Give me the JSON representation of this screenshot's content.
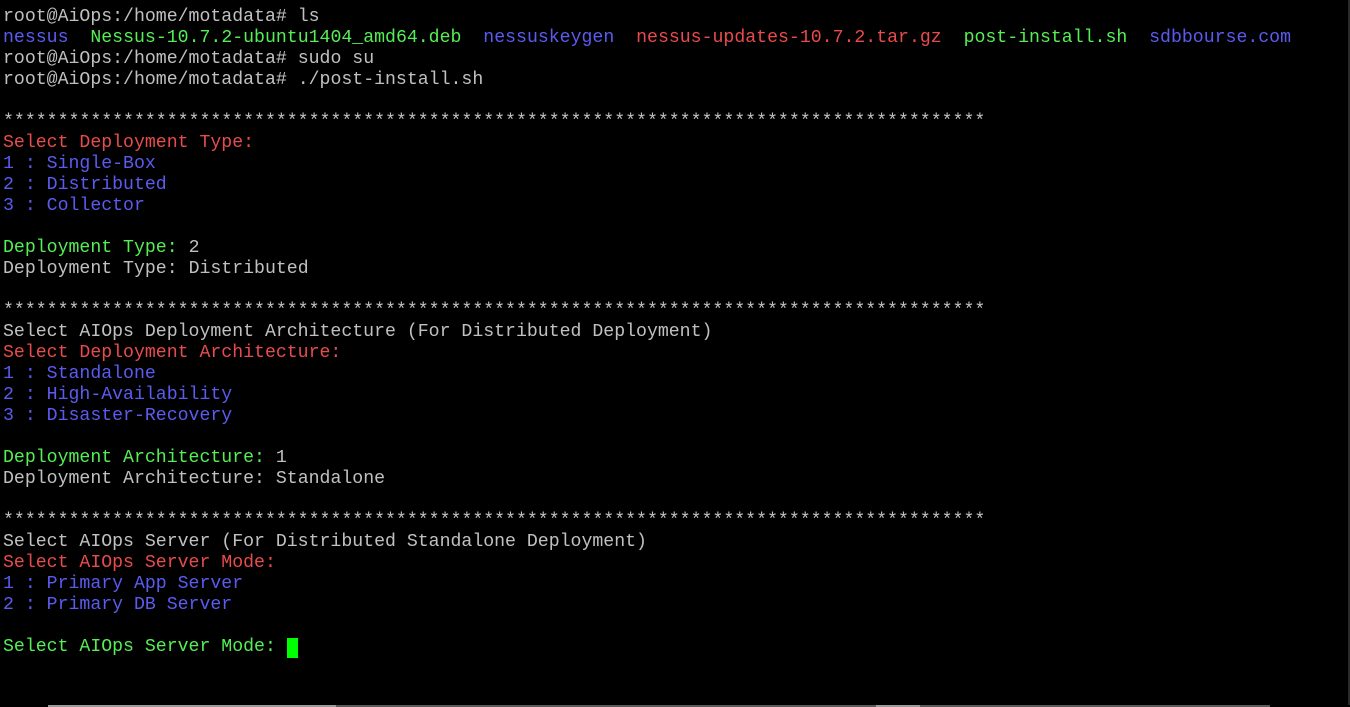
{
  "colors": {
    "background": "#000000",
    "default_text": "#c0c0c0",
    "red": "#e84b4b",
    "blue": "#5b5bf0",
    "green": "#55ee55",
    "cursor": "#00ff00"
  },
  "prompt": "root@AiOps:/home/motadata#",
  "commands": {
    "ls": "ls",
    "sudo": "sudo su",
    "script": "./post-install.sh"
  },
  "ls_output": [
    {
      "name": "nessus",
      "color": "blue"
    },
    {
      "name": "Nessus-10.7.2-ubuntu1404_amd64.deb",
      "color": "green"
    },
    {
      "name": "nessuskeygen",
      "color": "blue"
    },
    {
      "name": "nessus-updates-10.7.2.tar.gz",
      "color": "red"
    },
    {
      "name": "post-install.sh",
      "color": "green"
    },
    {
      "name": "sdbbourse.com",
      "color": "blue"
    }
  ],
  "separator": "******************************************************************************************",
  "deployment_type": {
    "title": "Select Deployment Type:",
    "options": [
      "1 : Single-Box",
      "2 : Distributed",
      "3 : Collector"
    ],
    "input_label": "Deployment Type:",
    "input_value": "2",
    "result_label": "Deployment Type:",
    "result_value": "Distributed"
  },
  "architecture": {
    "heading": "Select AIOps Deployment Architecture (For Distributed Deployment)",
    "title": "Select Deployment Architecture:",
    "options": [
      "1 : Standalone",
      "2 : High-Availability",
      "3 : Disaster-Recovery"
    ],
    "input_label": "Deployment Architecture:",
    "input_value": "1",
    "result_label": "Deployment Architecture:",
    "result_value": "Standalone"
  },
  "server_mode": {
    "heading": "Select AIOps Server (For Distributed Standalone Deployment)",
    "title": "Select AIOps Server Mode:",
    "options": [
      "1 : Primary App Server",
      "2 : Primary DB Server"
    ],
    "input_label": "Select AIOps Server Mode:"
  }
}
